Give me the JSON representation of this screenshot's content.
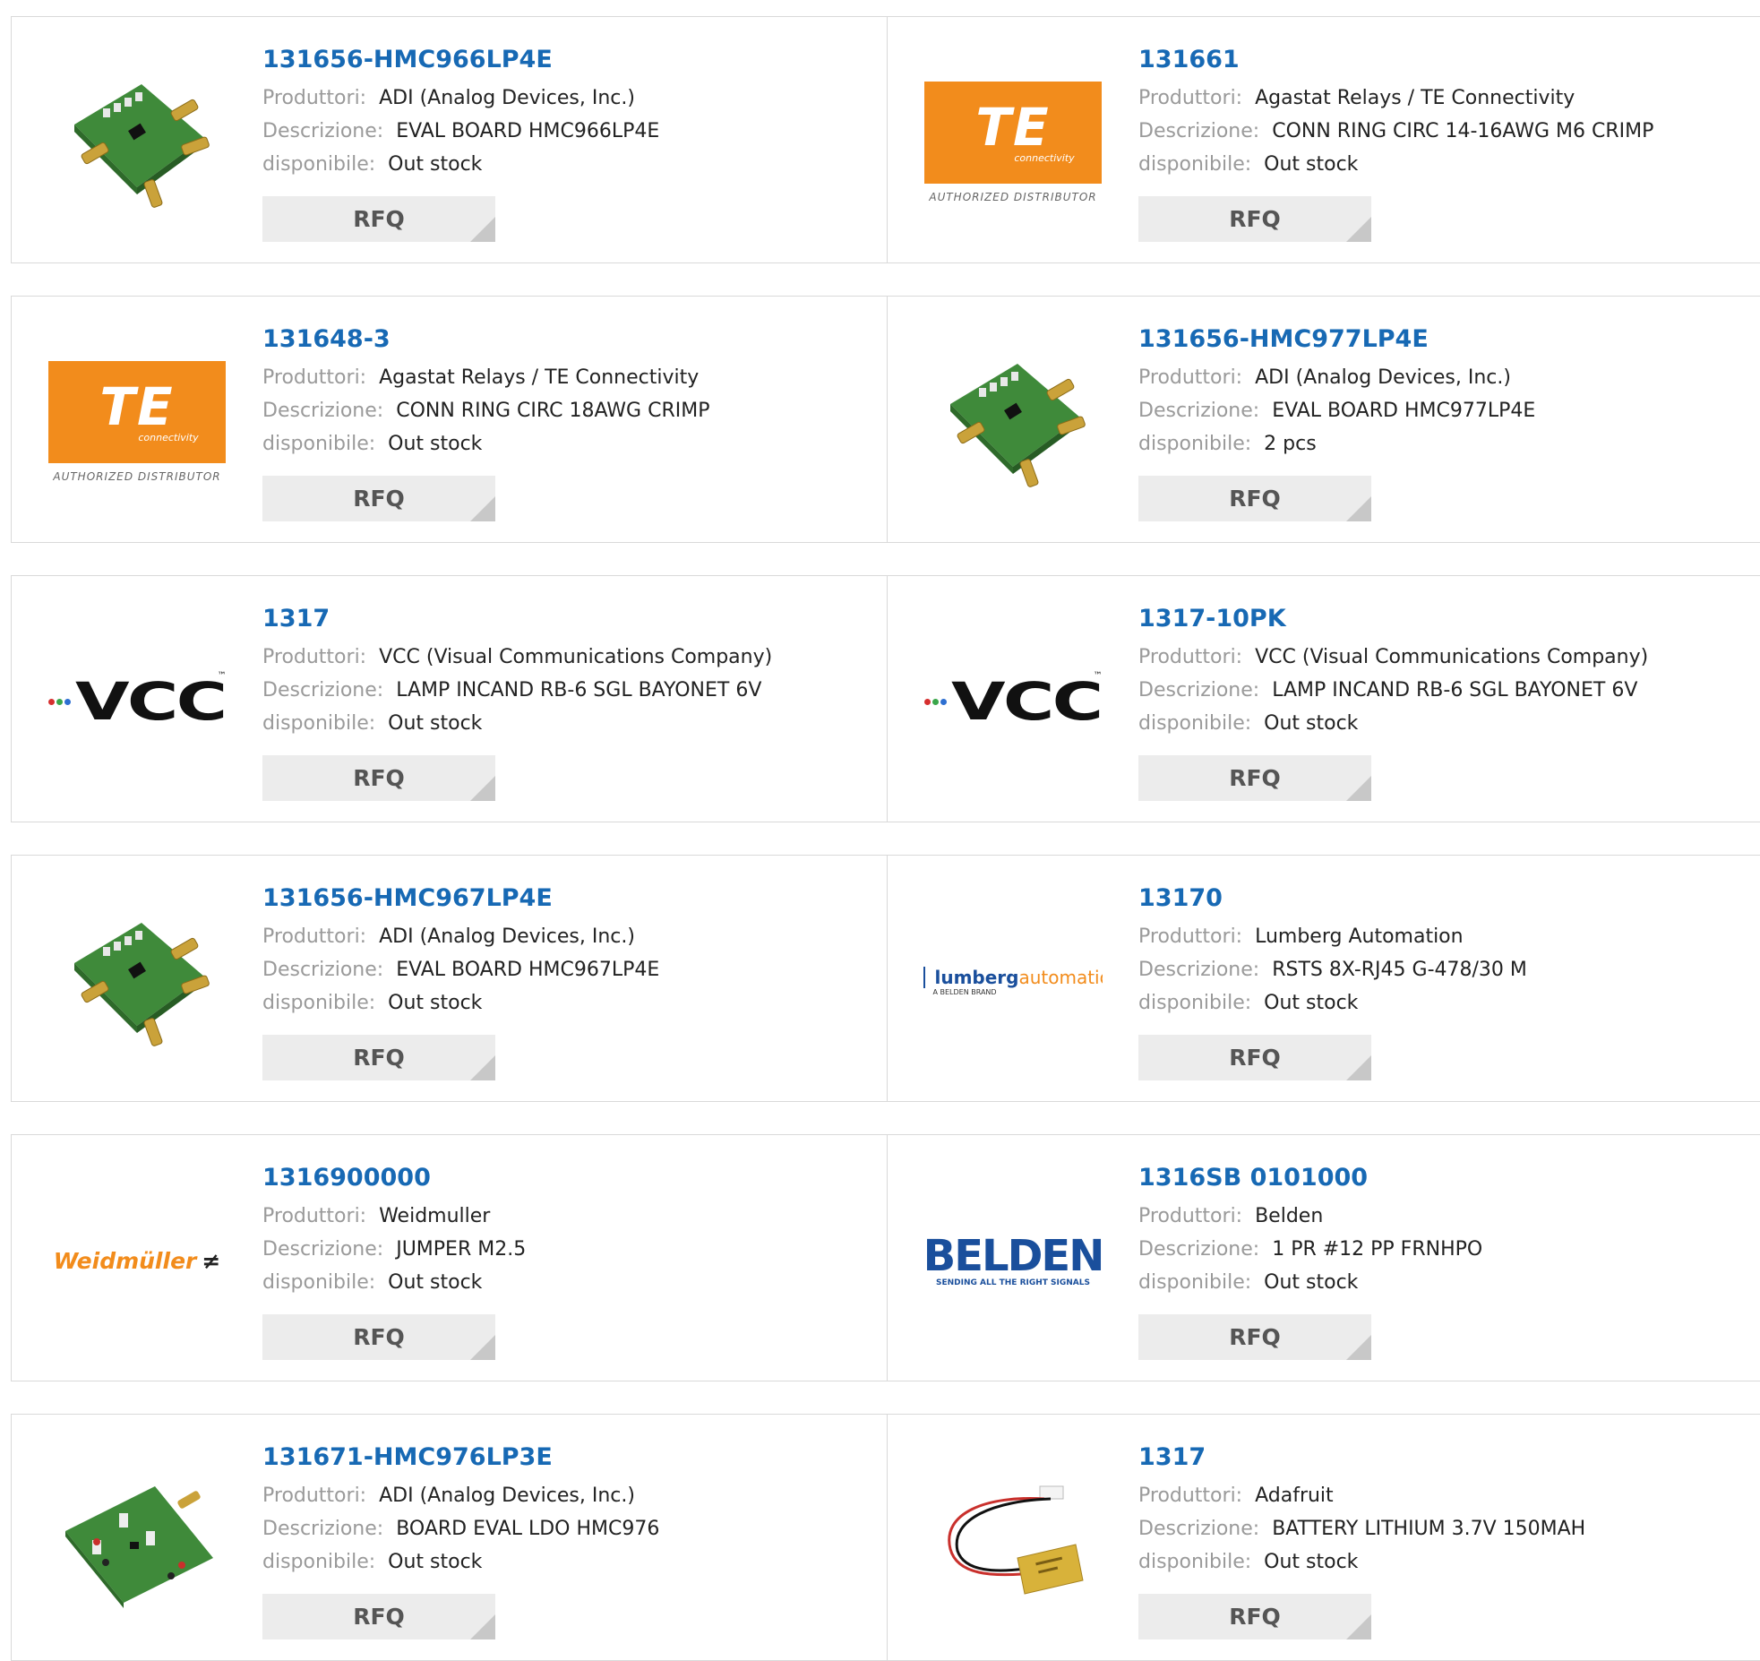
{
  "labels": {
    "manufacturer": "Produttori:",
    "description": "Descrizione:",
    "availability": "disponibile:",
    "rfq": "RFQ"
  },
  "logo_text": {
    "te_mark": "TE",
    "te_sub": "connectivity",
    "te_auth": "AUTHORIZED DISTRIBUTOR",
    "vcc": "VCC",
    "vcc_tm": "™",
    "weidmuller": "Weidmüller",
    "belden": "BELDEN",
    "belden_tag": "SENDING ALL THE RIGHT SIGNALS",
    "lumberg_a": "lumberg",
    "lumberg_b": "automation",
    "lumberg_sub": "A BELDEN BRAND"
  },
  "products": [
    {
      "part": "131656-HMC966LP4E",
      "manufacturer": "ADI (Analog Devices, Inc.)",
      "description": "EVAL BOARD HMC966LP4E",
      "availability": "Out stock",
      "image": "eval-board-pcb"
    },
    {
      "part": "131661",
      "manufacturer": "Agastat Relays / TE Connectivity",
      "description": "CONN RING CIRC 14-16AWG M6 CRIMP",
      "availability": "Out stock",
      "image": "te-logo"
    },
    {
      "part": "131648-3",
      "manufacturer": "Agastat Relays / TE Connectivity",
      "description": "CONN RING CIRC 18AWG CRIMP",
      "availability": "Out stock",
      "image": "te-logo"
    },
    {
      "part": "131656-HMC977LP4E",
      "manufacturer": "ADI (Analog Devices, Inc.)",
      "description": "EVAL BOARD HMC977LP4E",
      "availability": "2 pcs",
      "image": "eval-board-pcb"
    },
    {
      "part": "1317",
      "manufacturer": "VCC (Visual Communications Company)",
      "description": "LAMP INCAND RB-6 SGL BAYONET 6V",
      "availability": "Out stock",
      "image": "vcc-logo"
    },
    {
      "part": "1317-10PK",
      "manufacturer": "VCC (Visual Communications Company)",
      "description": "LAMP INCAND RB-6 SGL BAYONET 6V",
      "availability": "Out stock",
      "image": "vcc-logo"
    },
    {
      "part": "131656-HMC967LP4E",
      "manufacturer": "ADI (Analog Devices, Inc.)",
      "description": "EVAL BOARD HMC967LP4E",
      "availability": "Out stock",
      "image": "eval-board-pcb"
    },
    {
      "part": "13170",
      "manufacturer": "Lumberg Automation",
      "description": "RSTS 8X-RJ45 G-478/30 M",
      "availability": "Out stock",
      "image": "lumberg-logo"
    },
    {
      "part": "1316900000",
      "manufacturer": "Weidmuller",
      "description": "JUMPER M2.5",
      "availability": "Out stock",
      "image": "weidmuller-logo"
    },
    {
      "part": "1316SB 0101000",
      "manufacturer": "Belden",
      "description": "1 PR #12 PP FRNHPO",
      "availability": "Out stock",
      "image": "belden-logo"
    },
    {
      "part": "131671-HMC976LP3E",
      "manufacturer": "ADI (Analog Devices, Inc.)",
      "description": "BOARD EVAL LDO HMC976",
      "availability": "Out stock",
      "image": "ldo-board-pcb"
    },
    {
      "part": "1317",
      "manufacturer": "Adafruit",
      "description": "BATTERY LITHIUM 3.7V 150MAH",
      "availability": "Out stock",
      "image": "lipo-battery"
    }
  ]
}
